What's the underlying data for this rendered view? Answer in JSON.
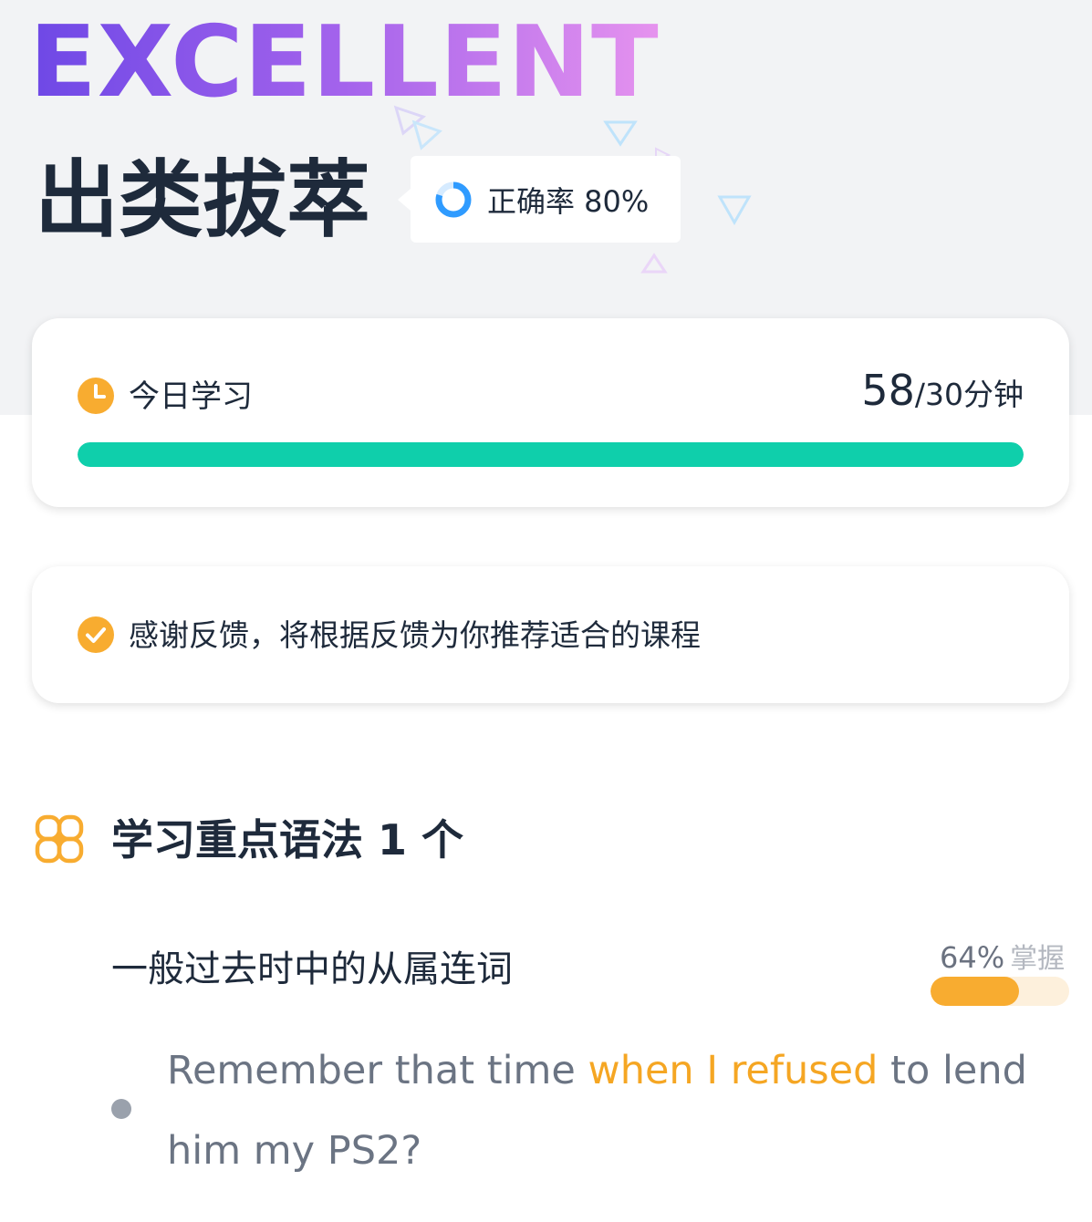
{
  "hero": {
    "banner_text": "EXCELLENT",
    "title": "出类拔萃",
    "accuracy_label": "正确率 80%",
    "accuracy_percent": 80
  },
  "study_card": {
    "label": "今日学习",
    "minutes_done": "58",
    "minutes_goal_text": "/30分钟",
    "progress_fraction": 1.0,
    "icon": "clock-icon"
  },
  "feedback_card": {
    "text": "感谢反馈，将根据反馈为你推荐适合的课程",
    "icon": "check-circle-icon"
  },
  "grammar_section": {
    "title": "学习重点语法 1 个",
    "icon": "grammar-icon",
    "item": {
      "title": "一般过去时中的从属连词",
      "mastery_percent_text": "64%",
      "mastery_word": "掌握",
      "mastery_fraction": 0.64,
      "example": {
        "before": "Remember that time ",
        "highlight": "when I refused",
        "after": " to lend him my PS2?"
      }
    }
  },
  "colors": {
    "accent_green": "#0fcfab",
    "accent_orange": "#f8ac30",
    "accent_blue": "#2f9bff",
    "title_dark": "#1e2a3b"
  }
}
